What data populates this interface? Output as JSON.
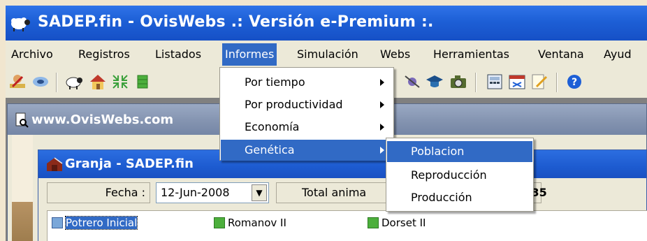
{
  "window": {
    "title": "SADEP.fin - OvisWebs  .: Versión e-Premium :."
  },
  "menubar": {
    "items": [
      "Archivo",
      "Registros",
      "Listados",
      "Informes",
      "Simulación",
      "Webs",
      "Herramientas",
      "Ventana",
      "Ayud"
    ],
    "active": "Informes"
  },
  "toolbar": {
    "icons": [
      "user-edit-icon",
      "disk-network-icon",
      "sheep-icon",
      "house-icon",
      "arrows-icon",
      "green-block-icon",
      "satellite-icon",
      "graduation-icon",
      "camera-icon",
      "calculator-icon",
      "calendar-icon",
      "edit-note-icon",
      "help-icon"
    ]
  },
  "informes_menu": {
    "items": [
      {
        "label": "Por tiempo",
        "submenu": true
      },
      {
        "label": "Por productividad",
        "submenu": true
      },
      {
        "label": "Economía",
        "submenu": true
      },
      {
        "label": "Genética",
        "submenu": true,
        "highlighted": true
      }
    ]
  },
  "genetica_menu": {
    "items": [
      {
        "label": "Poblacion",
        "highlighted": true
      },
      {
        "label": "Reproducción"
      },
      {
        "label": "Producción"
      }
    ]
  },
  "child_window_1": {
    "title": "www.OvisWebs.com"
  },
  "child_window_2": {
    "title": "Granja - SADEP.fin",
    "fecha_label": "Fecha :",
    "fecha_value": "12-Jun-2008",
    "total_label": "Total anima",
    "total_value": "l: 35",
    "list": [
      "Potrero Inicial",
      "Romanov II",
      "Dorset II"
    ]
  },
  "colors": {
    "titlebar": "#1d5fd6",
    "highlight": "#316ac5",
    "face": "#ece9d8"
  }
}
